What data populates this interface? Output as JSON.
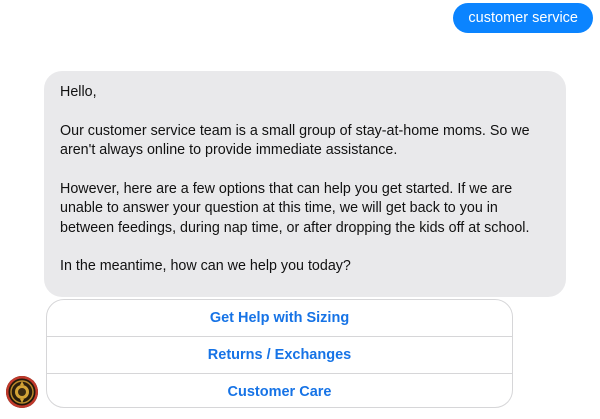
{
  "user_message": {
    "text": "customer service",
    "color": "#0b84ff"
  },
  "bot_message": {
    "paragraphs": [
      "Hello,",
      "Our customer service team is a small group of stay-at-home moms. So we aren't always online to provide immediate assistance.",
      "However, here are a few options that can help you get started. If we are unable to answer your question at this time, we will get back to you in between feedings, during nap time, or after dropping the kids off at school.",
      "In the meantime, how can we help you today?"
    ],
    "background": "#e9e9eb"
  },
  "quick_replies": [
    {
      "label": "Get Help with Sizing"
    },
    {
      "label": "Returns / Exchanges"
    },
    {
      "label": "Customer Care"
    }
  ],
  "avatar": {
    "icon": "brand-logo-icon"
  }
}
